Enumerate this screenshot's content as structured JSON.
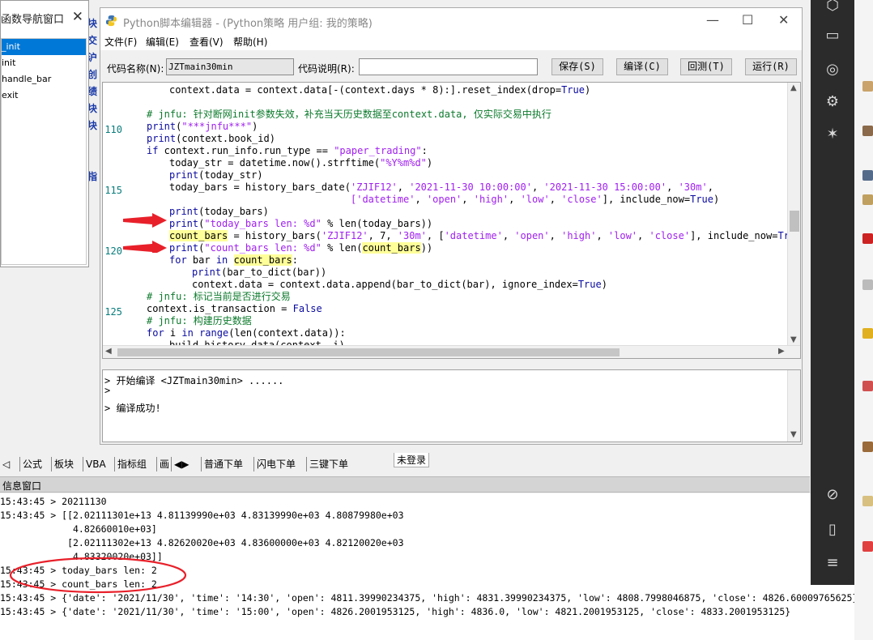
{
  "nav_window": {
    "title": "函数导航窗口",
    "items": [
      "_init",
      "init",
      "handle_bar",
      "exit"
    ],
    "behind_chars": [
      "块",
      "交",
      "沪",
      "创",
      "绩",
      "块",
      "块",
      "",
      "",
      "指"
    ]
  },
  "editor": {
    "title": "Python脚本编辑器 - (Python策略 用户组: 我的策略)",
    "menu": [
      "文件(F)",
      "编辑(E)",
      "查看(V)",
      "帮助(H)"
    ],
    "code_name_label": "代码名称(N):",
    "code_name_value": "JZTmain30min",
    "code_desc_label": "代码说明(R):",
    "code_desc_value": "",
    "buttons": [
      "保存(S)",
      "编译(C)",
      "回测(T)",
      "运行(R)"
    ],
    "line_numbers": [
      "110",
      "115",
      "120",
      "125"
    ],
    "code_lines": [
      {
        "indent": 1,
        "parts": [
          {
            "t": "context.data = context.data[-(context.days * 8):].reset_index(drop=",
            "c": ""
          },
          {
            "t": "True",
            "c": "kw"
          },
          {
            "t": ")",
            "c": ""
          }
        ]
      },
      {
        "indent": 0,
        "parts": [
          {
            "t": "",
            "c": ""
          }
        ]
      },
      {
        "indent": 0,
        "parts": [
          {
            "t": "# jnfu: 针对断网init参数失效，补充当天历史数据至context.data, 仅实际交易中执行",
            "c": "cm"
          }
        ]
      },
      {
        "indent": 0,
        "parts": [
          {
            "t": "print",
            "c": "kw"
          },
          {
            "t": "(",
            "c": ""
          },
          {
            "t": "\"***jnfu***\"",
            "c": "st"
          },
          {
            "t": ")",
            "c": ""
          }
        ]
      },
      {
        "indent": 0,
        "parts": [
          {
            "t": "print",
            "c": "kw"
          },
          {
            "t": "(context.book_id)",
            "c": ""
          }
        ]
      },
      {
        "indent": 0,
        "parts": [
          {
            "t": "if",
            "c": "kw"
          },
          {
            "t": " context.run_info.run_type == ",
            "c": ""
          },
          {
            "t": "\"paper_trading\"",
            "c": "st"
          },
          {
            "t": ":",
            "c": ""
          }
        ]
      },
      {
        "indent": 1,
        "parts": [
          {
            "t": "today_str = datetime.now().strftime(",
            "c": ""
          },
          {
            "t": "\"%Y%m%d\"",
            "c": "st"
          },
          {
            "t": ")",
            "c": ""
          }
        ]
      },
      {
        "indent": 1,
        "parts": [
          {
            "t": "print",
            "c": "kw"
          },
          {
            "t": "(today_str)",
            "c": ""
          }
        ]
      },
      {
        "indent": 1,
        "parts": [
          {
            "t": "today_bars = history_bars_date(",
            "c": ""
          },
          {
            "t": "'ZJIF12'",
            "c": "st"
          },
          {
            "t": ", ",
            "c": ""
          },
          {
            "t": "'2021-11-30 10:00:00'",
            "c": "st"
          },
          {
            "t": ", ",
            "c": ""
          },
          {
            "t": "'2021-11-30 15:00:00'",
            "c": "st"
          },
          {
            "t": ", ",
            "c": ""
          },
          {
            "t": "'30m'",
            "c": "st"
          },
          {
            "t": ",",
            "c": ""
          }
        ]
      },
      {
        "indent": 9,
        "parts": [
          {
            "t": "['datetime'",
            "c": "st"
          },
          {
            "t": ", ",
            "c": ""
          },
          {
            "t": "'open'",
            "c": "st"
          },
          {
            "t": ", ",
            "c": ""
          },
          {
            "t": "'high'",
            "c": "st"
          },
          {
            "t": ", ",
            "c": ""
          },
          {
            "t": "'low'",
            "c": "st"
          },
          {
            "t": ", ",
            "c": ""
          },
          {
            "t": "'close'",
            "c": "st"
          },
          {
            "t": "], include_now=",
            "c": ""
          },
          {
            "t": "True",
            "c": "kw"
          },
          {
            "t": ")",
            "c": ""
          }
        ]
      },
      {
        "indent": 1,
        "parts": [
          {
            "t": "print",
            "c": "kw"
          },
          {
            "t": "(today_bars)",
            "c": ""
          }
        ]
      },
      {
        "indent": 1,
        "parts": [
          {
            "t": "print",
            "c": "kw"
          },
          {
            "t": "(",
            "c": ""
          },
          {
            "t": "\"today_bars len: %d\"",
            "c": "st"
          },
          {
            "t": " % len(today_bars))",
            "c": ""
          }
        ]
      },
      {
        "indent": 1,
        "parts": [
          {
            "t": "count_bars",
            "c": "hl"
          },
          {
            "t": " = history_bars(",
            "c": ""
          },
          {
            "t": "'ZJIF12'",
            "c": "st"
          },
          {
            "t": ", 7, ",
            "c": ""
          },
          {
            "t": "'30m'",
            "c": "st"
          },
          {
            "t": ", [",
            "c": ""
          },
          {
            "t": "'datetime'",
            "c": "st"
          },
          {
            "t": ", ",
            "c": ""
          },
          {
            "t": "'open'",
            "c": "st"
          },
          {
            "t": ", ",
            "c": ""
          },
          {
            "t": "'high'",
            "c": "st"
          },
          {
            "t": ", ",
            "c": ""
          },
          {
            "t": "'low'",
            "c": "st"
          },
          {
            "t": ", ",
            "c": ""
          },
          {
            "t": "'close'",
            "c": "st"
          },
          {
            "t": "], include_now=",
            "c": ""
          },
          {
            "t": "True",
            "c": "kw"
          },
          {
            "t": ")",
            "c": ""
          }
        ]
      },
      {
        "indent": 1,
        "parts": [
          {
            "t": "print",
            "c": "kw"
          },
          {
            "t": "(",
            "c": ""
          },
          {
            "t": "\"count_bars len: %d\"",
            "c": "st"
          },
          {
            "t": " % len(",
            "c": ""
          },
          {
            "t": "count_bars",
            "c": "hl"
          },
          {
            "t": "))",
            "c": ""
          }
        ]
      },
      {
        "indent": 1,
        "parts": [
          {
            "t": "for",
            "c": "kw"
          },
          {
            "t": " bar ",
            "c": ""
          },
          {
            "t": "in",
            "c": "kw"
          },
          {
            "t": " ",
            "c": ""
          },
          {
            "t": "count_bars",
            "c": "hl"
          },
          {
            "t": ":",
            "c": ""
          }
        ]
      },
      {
        "indent": 2,
        "parts": [
          {
            "t": "print",
            "c": "kw"
          },
          {
            "t": "(bar_to_dict(bar))",
            "c": ""
          }
        ]
      },
      {
        "indent": 2,
        "parts": [
          {
            "t": "context.data = context.data.append(bar_to_dict(bar), ignore_index=",
            "c": ""
          },
          {
            "t": "True",
            "c": "kw"
          },
          {
            "t": ")",
            "c": ""
          }
        ]
      },
      {
        "indent": 0,
        "parts": [
          {
            "t": "# jnfu: 标记当前是否进行交易",
            "c": "cm"
          }
        ]
      },
      {
        "indent": 0,
        "parts": [
          {
            "t": "context.is_transaction = ",
            "c": ""
          },
          {
            "t": "False",
            "c": "kw"
          }
        ]
      },
      {
        "indent": 0,
        "parts": [
          {
            "t": "# jnfu: 构建历史数据",
            "c": "cm"
          }
        ]
      },
      {
        "indent": 0,
        "parts": [
          {
            "t": "for",
            "c": "kw"
          },
          {
            "t": " i ",
            "c": ""
          },
          {
            "t": "in",
            "c": "kw"
          },
          {
            "t": " ",
            "c": ""
          },
          {
            "t": "range",
            "c": "kw"
          },
          {
            "t": "(len(context.data)):",
            "c": ""
          }
        ]
      },
      {
        "indent": 1,
        "parts": [
          {
            "t": "build_history_data(context, i)",
            "c": ""
          }
        ]
      }
    ],
    "output_lines": [
      "> 开始编译 <JZTmain30min> ......",
      ">",
      "",
      "> 编译成功!"
    ]
  },
  "tabs_left": [
    "公式",
    "板块",
    "VBA",
    "指标组",
    "画"
  ],
  "tabs_right": [
    "普通下单",
    "闪电下单",
    "三键下单"
  ],
  "login_status": "未登录",
  "info_window": {
    "title": "信息窗口",
    "lines": [
      "15:43:45 > 20211130",
      "15:43:45 > [[2.02111301e+13 4.81139990e+03 4.83139990e+03 4.80879980e+03",
      "             4.82660010e+03]",
      "            [2.02111302e+13 4.82620020e+03 4.83600000e+03 4.82120020e+03",
      "             4.83320020e+03]]",
      "15:43:45 > today_bars len: 2",
      "15:43:45 > count_bars len: 2",
      "15:43:45 > {'date': '2021/11/30', 'time': '14:30', 'open': 4811.39990234375, 'high': 4831.39990234375, 'low': 4808.7998046875, 'close': 4826.60009765625}",
      "15:43:45 > {'date': '2021/11/30', 'time': '15:00', 'open': 4826.2001953125, 'high': 4836.0, 'low': 4821.2001953125, 'close': 4833.2001953125}"
    ]
  },
  "annotation_color": "#e8202a"
}
